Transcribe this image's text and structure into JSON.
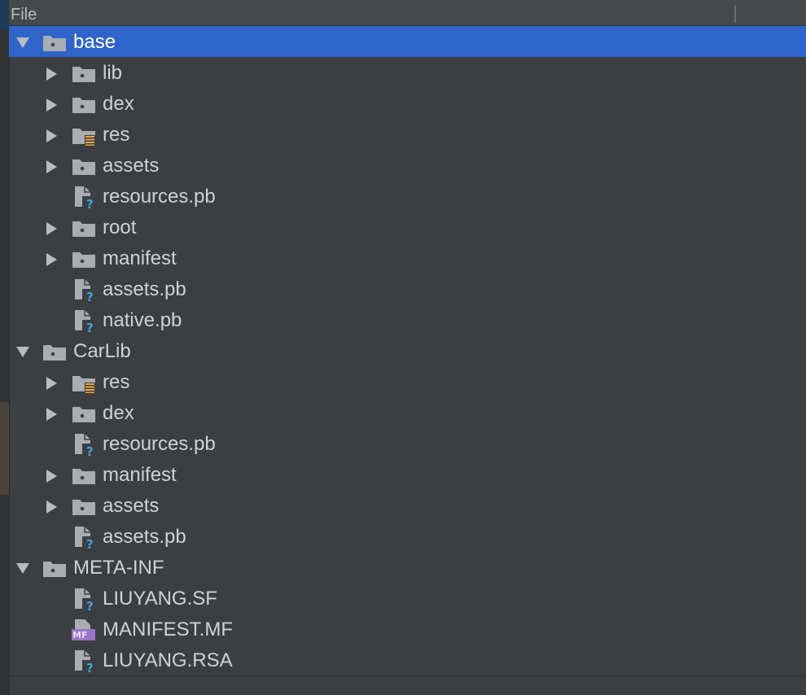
{
  "header": {
    "title": "File"
  },
  "colors": {
    "background": "#3c3f41",
    "selection": "#2f65ca",
    "folder": "#a8adb1",
    "unknown_file_badge": "#3ba6e6",
    "res_folder_badge": "#e8a33d",
    "manifest_badge": "#9876c6"
  },
  "tree": [
    {
      "label": "base",
      "depth": 0,
      "arrow": "expanded",
      "icon": "folder-icon",
      "selected": true
    },
    {
      "label": "lib",
      "depth": 1,
      "arrow": "collapsed",
      "icon": "folder-icon"
    },
    {
      "label": "dex",
      "depth": 1,
      "arrow": "collapsed",
      "icon": "folder-icon"
    },
    {
      "label": "res",
      "depth": 1,
      "arrow": "collapsed",
      "icon": "resource-folder-icon"
    },
    {
      "label": "assets",
      "depth": 1,
      "arrow": "collapsed",
      "icon": "folder-icon"
    },
    {
      "label": "resources.pb",
      "depth": 1,
      "arrow": "none",
      "icon": "unknown-file-icon"
    },
    {
      "label": "root",
      "depth": 1,
      "arrow": "collapsed",
      "icon": "folder-icon"
    },
    {
      "label": "manifest",
      "depth": 1,
      "arrow": "collapsed",
      "icon": "folder-icon"
    },
    {
      "label": "assets.pb",
      "depth": 1,
      "arrow": "none",
      "icon": "unknown-file-icon"
    },
    {
      "label": "native.pb",
      "depth": 1,
      "arrow": "none",
      "icon": "unknown-file-icon"
    },
    {
      "label": "CarLib",
      "depth": 0,
      "arrow": "expanded",
      "icon": "folder-icon"
    },
    {
      "label": "res",
      "depth": 1,
      "arrow": "collapsed",
      "icon": "resource-folder-icon"
    },
    {
      "label": "dex",
      "depth": 1,
      "arrow": "collapsed",
      "icon": "folder-icon"
    },
    {
      "label": "resources.pb",
      "depth": 1,
      "arrow": "none",
      "icon": "unknown-file-icon"
    },
    {
      "label": "manifest",
      "depth": 1,
      "arrow": "collapsed",
      "icon": "folder-icon"
    },
    {
      "label": "assets",
      "depth": 1,
      "arrow": "collapsed",
      "icon": "folder-icon"
    },
    {
      "label": "assets.pb",
      "depth": 1,
      "arrow": "none",
      "icon": "unknown-file-icon"
    },
    {
      "label": "META-INF",
      "depth": 0,
      "arrow": "expanded",
      "icon": "folder-icon"
    },
    {
      "label": "LIUYANG.SF",
      "depth": 1,
      "arrow": "none",
      "icon": "unknown-file-icon"
    },
    {
      "label": "MANIFEST.MF",
      "depth": 1,
      "arrow": "none",
      "icon": "manifest-file-icon",
      "badge": "MF"
    },
    {
      "label": "LIUYANG.RSA",
      "depth": 1,
      "arrow": "none",
      "icon": "unknown-file-icon"
    }
  ]
}
